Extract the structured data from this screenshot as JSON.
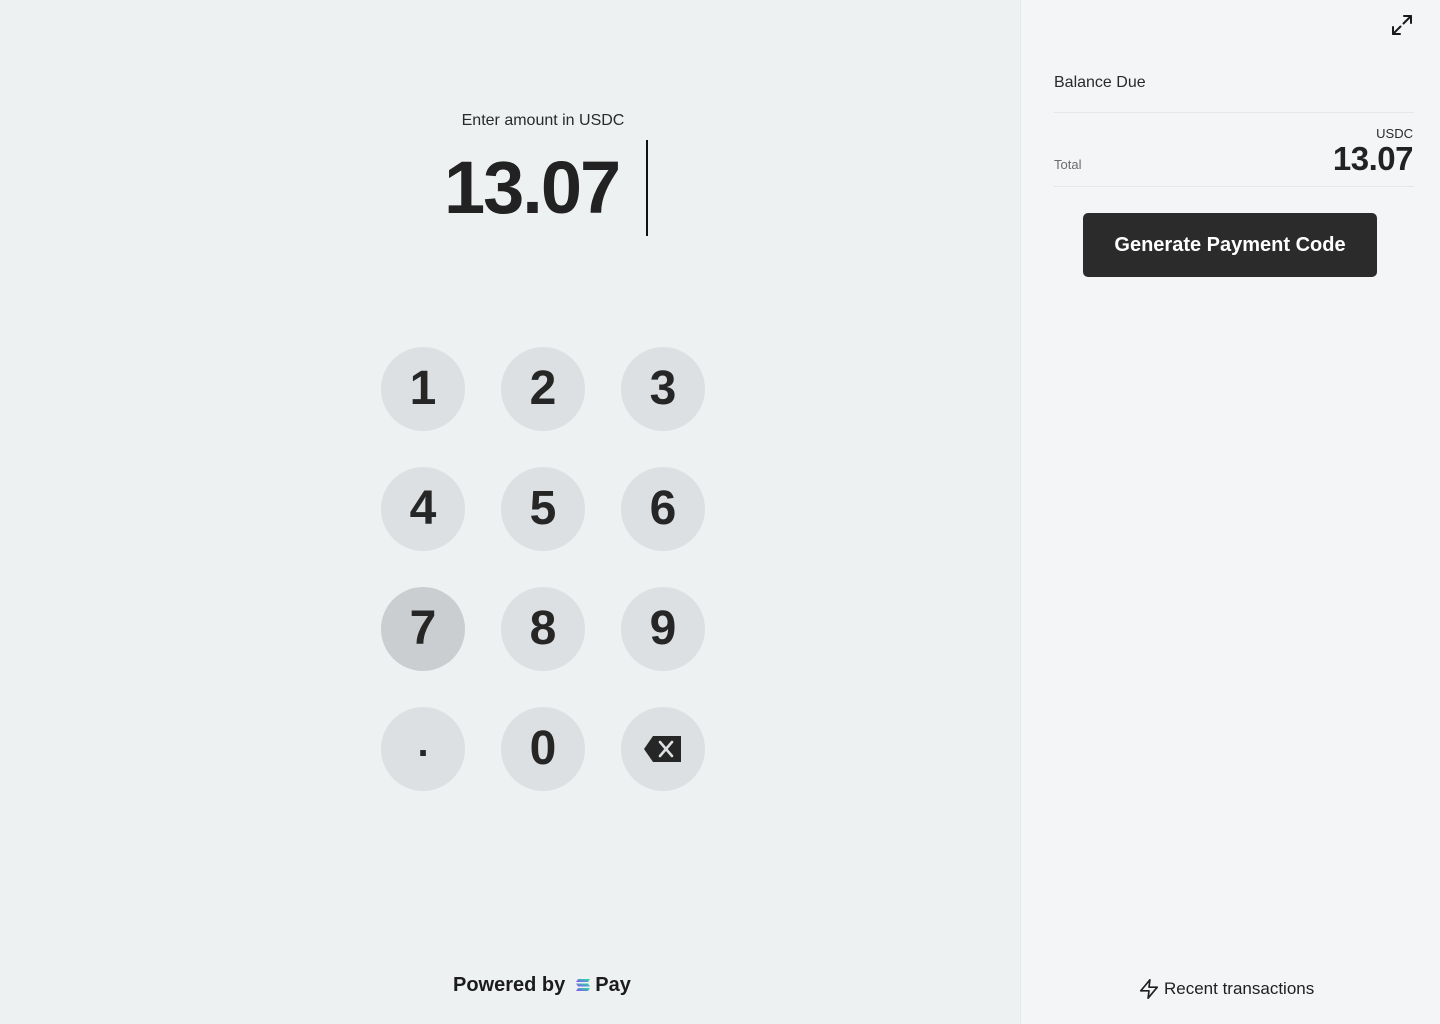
{
  "entry": {
    "label": "Enter amount in USDC",
    "value": "13.07"
  },
  "keypad": {
    "keys": [
      "1",
      "2",
      "3",
      "4",
      "5",
      "6",
      "7",
      "8",
      "9",
      ".",
      "0"
    ],
    "backspace_icon": "backspace-icon",
    "pressed_key": "7"
  },
  "footer": {
    "powered_by": "Powered by",
    "brand_name": "Pay",
    "brand_icon": "solana-logo-icon"
  },
  "summary": {
    "expand_icon": "expand-icon",
    "title": "Balance Due",
    "total_label": "Total",
    "currency": "USDC",
    "total_value": "13.07"
  },
  "actions": {
    "generate_label": "Generate Payment Code",
    "recent_label": "Recent transactions",
    "recent_icon": "lightning-bolt-icon"
  },
  "colors": {
    "left_background": "#eef1f2",
    "right_background": "#f4f5f6",
    "key_background": "#dde0e2",
    "key_pressed_background": "#cbced0",
    "primary_button": "#2b2b2b",
    "brand_gradient": [
      "#9945ff",
      "#14f195"
    ]
  }
}
